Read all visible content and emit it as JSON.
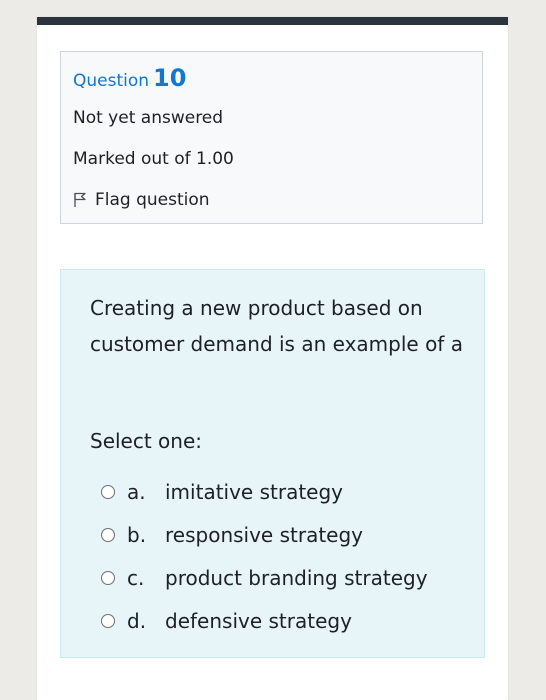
{
  "info": {
    "question_label": "Question",
    "question_number": "10",
    "state": "Not yet answered",
    "grade": "Marked out of 1.00",
    "flag_label": "Flag question"
  },
  "question": {
    "text": "Creating a new product based on customer demand is an example of a",
    "prompt": "Select one:",
    "options": [
      {
        "letter": "a.",
        "label": "imitative strategy"
      },
      {
        "letter": "b.",
        "label": "responsive strategy"
      },
      {
        "letter": "c.",
        "label": "product branding strategy"
      },
      {
        "letter": "d.",
        "label": "defensive strategy"
      }
    ]
  },
  "colors": {
    "accent": "#1177d1",
    "top_bar": "#2c3440",
    "question_background": "#e7f4f8",
    "info_background": "#f8f9fa"
  }
}
